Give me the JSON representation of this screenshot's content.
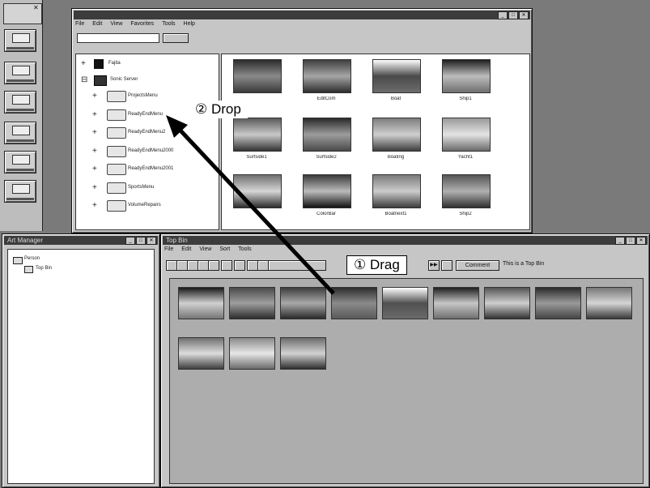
{
  "sidebar": {
    "top_label": "",
    "buttons": [
      "",
      "",
      "",
      "",
      "",
      ""
    ]
  },
  "explorer": {
    "title": "",
    "menu": [
      "File",
      "Edit",
      "View",
      "Favorites",
      "Tools",
      "Help"
    ],
    "tree": [
      {
        "label": "Fajita"
      },
      {
        "label": "Sonic Server"
      },
      {
        "label": "ProjectsMenu"
      },
      {
        "label": "ReadyEndMenu"
      },
      {
        "label": "ReadyEndMenu2"
      },
      {
        "label": "ReadyEndMenu2000"
      },
      {
        "label": "ReadyEndMenu2001"
      },
      {
        "label": "SportsMenu"
      },
      {
        "label": "VolumeRepairs"
      }
    ],
    "thumbnails": [
      {
        "caption": "",
        "colors": [
          "#2b2b2b",
          "#8a8a8a",
          "#3a3a3a"
        ]
      },
      {
        "caption": "EditCom",
        "colors": [
          "#3f3f3f",
          "#a5a5a5",
          "#2d2d2d"
        ]
      },
      {
        "caption": "Boat",
        "colors": [
          "#ffffff",
          "#4a4a4a",
          "#6c6c6c"
        ]
      },
      {
        "caption": "Ship1",
        "colors": [
          "#1f1f1f",
          "#bdbdbd",
          "#6f6f6f"
        ]
      },
      {
        "caption": "Surfside1",
        "colors": [
          "#5a5a5a",
          "#c9c9c9",
          "#333333"
        ]
      },
      {
        "caption": "Surfside2",
        "colors": [
          "#2a2a2a",
          "#9c9c9c",
          "#4a4a4a"
        ]
      },
      {
        "caption": "Boating",
        "colors": [
          "#7d7d7d",
          "#cfcfcf",
          "#3d3d3d"
        ]
      },
      {
        "caption": "Yacht1",
        "colors": [
          "#9a9a9a",
          "#e4e4e4",
          "#6a6a6a"
        ]
      },
      {
        "caption": "",
        "colors": [
          "#6f6f6f",
          "#d6d6d6",
          "#2c2c2c"
        ]
      },
      {
        "caption": "ColorBar",
        "colors": [
          "#3a3a3a",
          "#bbbbbb",
          "#111111"
        ]
      },
      {
        "caption": "Boatnext1",
        "colors": [
          "#7a7a7a",
          "#cccccc",
          "#3c3c3c"
        ]
      },
      {
        "caption": "Ship2",
        "colors": [
          "#545454",
          "#b0b0b0",
          "#2f2f2f"
        ]
      }
    ]
  },
  "manager": {
    "title": "Art Manager",
    "tree": [
      "Person",
      "Top Bin"
    ]
  },
  "bin": {
    "title": "Top Bin",
    "menu": [
      "File",
      "Edit",
      "View",
      "Sort",
      "Tools"
    ],
    "comment_button": "Comment",
    "comment_text": "This is a Top Bin",
    "thumbnails": [
      {
        "caption": "",
        "colors": [
          "#1a1a1a",
          "#d0d0d0",
          "#777777"
        ]
      },
      {
        "caption": "",
        "colors": [
          "#4a4a4a",
          "#9e9e9e",
          "#2e2e2e"
        ]
      },
      {
        "caption": "",
        "colors": [
          "#3d3d3d",
          "#a8a8a8",
          "#2a2a2a"
        ]
      },
      {
        "caption": "",
        "colors": [
          "#2d2d2d",
          "#8a8a8a",
          "#5a5a5a"
        ]
      },
      {
        "caption": "",
        "colors": [
          "#ffffff",
          "#505050",
          "#6a6a6a"
        ]
      },
      {
        "caption": "",
        "colors": [
          "#1f1f1f",
          "#c6c6c6",
          "#707070"
        ]
      },
      {
        "caption": "",
        "colors": [
          "#555555",
          "#cfcfcf",
          "#333333"
        ]
      },
      {
        "caption": "",
        "colors": [
          "#2a2a2a",
          "#9a9a9a",
          "#454545"
        ]
      },
      {
        "caption": "",
        "colors": [
          "#777777",
          "#d5d5d5",
          "#3a3a3a"
        ]
      },
      {
        "caption": "",
        "colors": [
          "#707070",
          "#dcdcdc",
          "#3e3e3e"
        ]
      },
      {
        "caption": "",
        "colors": [
          "#8a8a8a",
          "#e6e6e6",
          "#6a6a6a"
        ]
      },
      {
        "caption": "",
        "colors": [
          "#6d6d6d",
          "#d2d2d2",
          "#2e2e2e"
        ]
      }
    ]
  },
  "callouts": {
    "drag": "① Drag",
    "drop": "② Drop"
  }
}
